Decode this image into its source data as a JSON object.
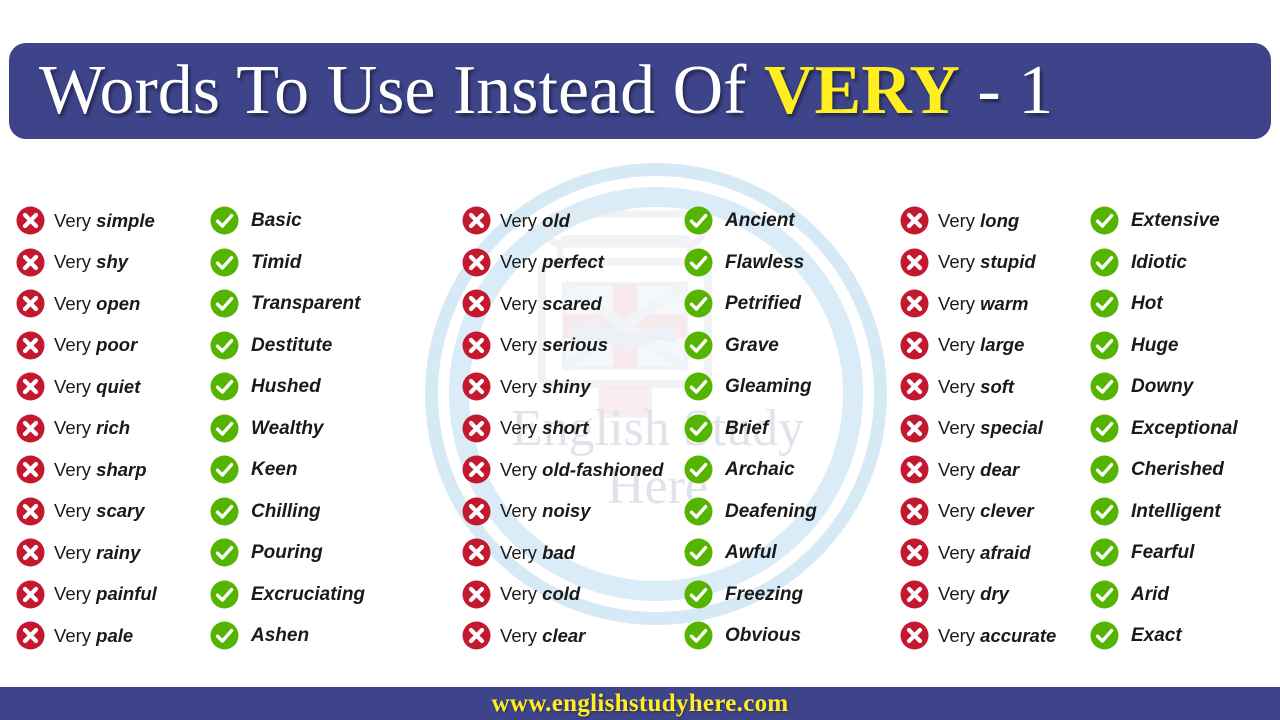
{
  "header": {
    "text_before": "Words To Use Instead Of ",
    "accent": "VERY",
    "text_after": " - 1",
    "full_title": "Words To Use Instead Of VERY - 1",
    "bar_color": "#3e4489",
    "text_color": "#ffffff",
    "accent_color": "#ffef20"
  },
  "watermark": {
    "line1": "English Study",
    "line2": "Here",
    "circle_color": "#d9ecf7",
    "text_color": "#dfe3ea"
  },
  "icons": {
    "bad": "cross-circle-icon",
    "good": "check-circle-icon",
    "bad_color": "#c4182e",
    "good_color": "#55b400"
  },
  "prefix": "Very ",
  "footer": {
    "url": "www.englishstudyhere.com",
    "bar_color": "#3e4489",
    "text_color": "#ffef20"
  },
  "columns": [
    {
      "id": "col-1-bad",
      "kind": "bad",
      "items": [
        "simple",
        "shy",
        "open",
        "poor",
        "quiet",
        "rich",
        "sharp",
        "scary",
        "rainy",
        "painful",
        "pale"
      ]
    },
    {
      "id": "col-2-good",
      "kind": "good",
      "items": [
        "Basic",
        "Timid",
        "Transparent",
        "Destitute",
        "Hushed",
        "Wealthy",
        "Keen",
        "Chilling",
        "Pouring",
        "Excruciating",
        "Ashen"
      ]
    },
    {
      "id": "col-3-bad",
      "kind": "bad",
      "items": [
        "old",
        "perfect",
        "scared",
        "serious",
        "shiny",
        "short",
        "old-fashioned",
        "noisy",
        "bad",
        "cold",
        "clear"
      ]
    },
    {
      "id": "col-4-good",
      "kind": "good",
      "items": [
        "Ancient",
        "Flawless",
        "Petrified",
        "Grave",
        "Gleaming",
        "Brief",
        "Archaic",
        "Deafening",
        "Awful",
        "Freezing",
        "Obvious"
      ]
    },
    {
      "id": "col-5-bad",
      "kind": "bad",
      "items": [
        "long",
        "stupid",
        "warm",
        "large",
        "soft",
        "special",
        "dear",
        "clever",
        "afraid",
        "dry",
        "accurate"
      ]
    },
    {
      "id": "col-6-good",
      "kind": "good",
      "items": [
        "Extensive",
        "Idiotic",
        "Hot",
        "Huge",
        "Downy",
        "Exceptional",
        "Cherished",
        "Intelligent",
        "Fearful",
        "Arid",
        "Exact"
      ]
    }
  ],
  "pairs": [
    {
      "very": "Very simple",
      "use": "Basic"
    },
    {
      "very": "Very shy",
      "use": "Timid"
    },
    {
      "very": "Very open",
      "use": "Transparent"
    },
    {
      "very": "Very poor",
      "use": "Destitute"
    },
    {
      "very": "Very quiet",
      "use": "Hushed"
    },
    {
      "very": "Very rich",
      "use": "Wealthy"
    },
    {
      "very": "Very sharp",
      "use": "Keen"
    },
    {
      "very": "Very scary",
      "use": "Chilling"
    },
    {
      "very": "Very rainy",
      "use": "Pouring"
    },
    {
      "very": "Very painful",
      "use": "Excruciating"
    },
    {
      "very": "Very pale",
      "use": "Ashen"
    },
    {
      "very": "Very old",
      "use": "Ancient"
    },
    {
      "very": "Very perfect",
      "use": "Flawless"
    },
    {
      "very": "Very scared",
      "use": "Petrified"
    },
    {
      "very": "Very serious",
      "use": "Grave"
    },
    {
      "very": "Very shiny",
      "use": "Gleaming"
    },
    {
      "very": "Very short",
      "use": "Brief"
    },
    {
      "very": "Very old-fashioned",
      "use": "Archaic"
    },
    {
      "very": "Very noisy",
      "use": "Deafening"
    },
    {
      "very": "Very bad",
      "use": "Awful"
    },
    {
      "very": "Very cold",
      "use": "Freezing"
    },
    {
      "very": "Very clear",
      "use": "Obvious"
    },
    {
      "very": "Very long",
      "use": "Extensive"
    },
    {
      "very": "Very stupid",
      "use": "Idiotic"
    },
    {
      "very": "Very warm",
      "use": "Hot"
    },
    {
      "very": "Very large",
      "use": "Huge"
    },
    {
      "very": "Very soft",
      "use": "Downy"
    },
    {
      "very": "Very special",
      "use": "Exceptional"
    },
    {
      "very": "Very dear",
      "use": "Cherished"
    },
    {
      "very": "Very clever",
      "use": "Intelligent"
    },
    {
      "very": "Very afraid",
      "use": "Fearful"
    },
    {
      "very": "Very dry",
      "use": "Arid"
    },
    {
      "very": "Very accurate",
      "use": "Exact"
    }
  ]
}
